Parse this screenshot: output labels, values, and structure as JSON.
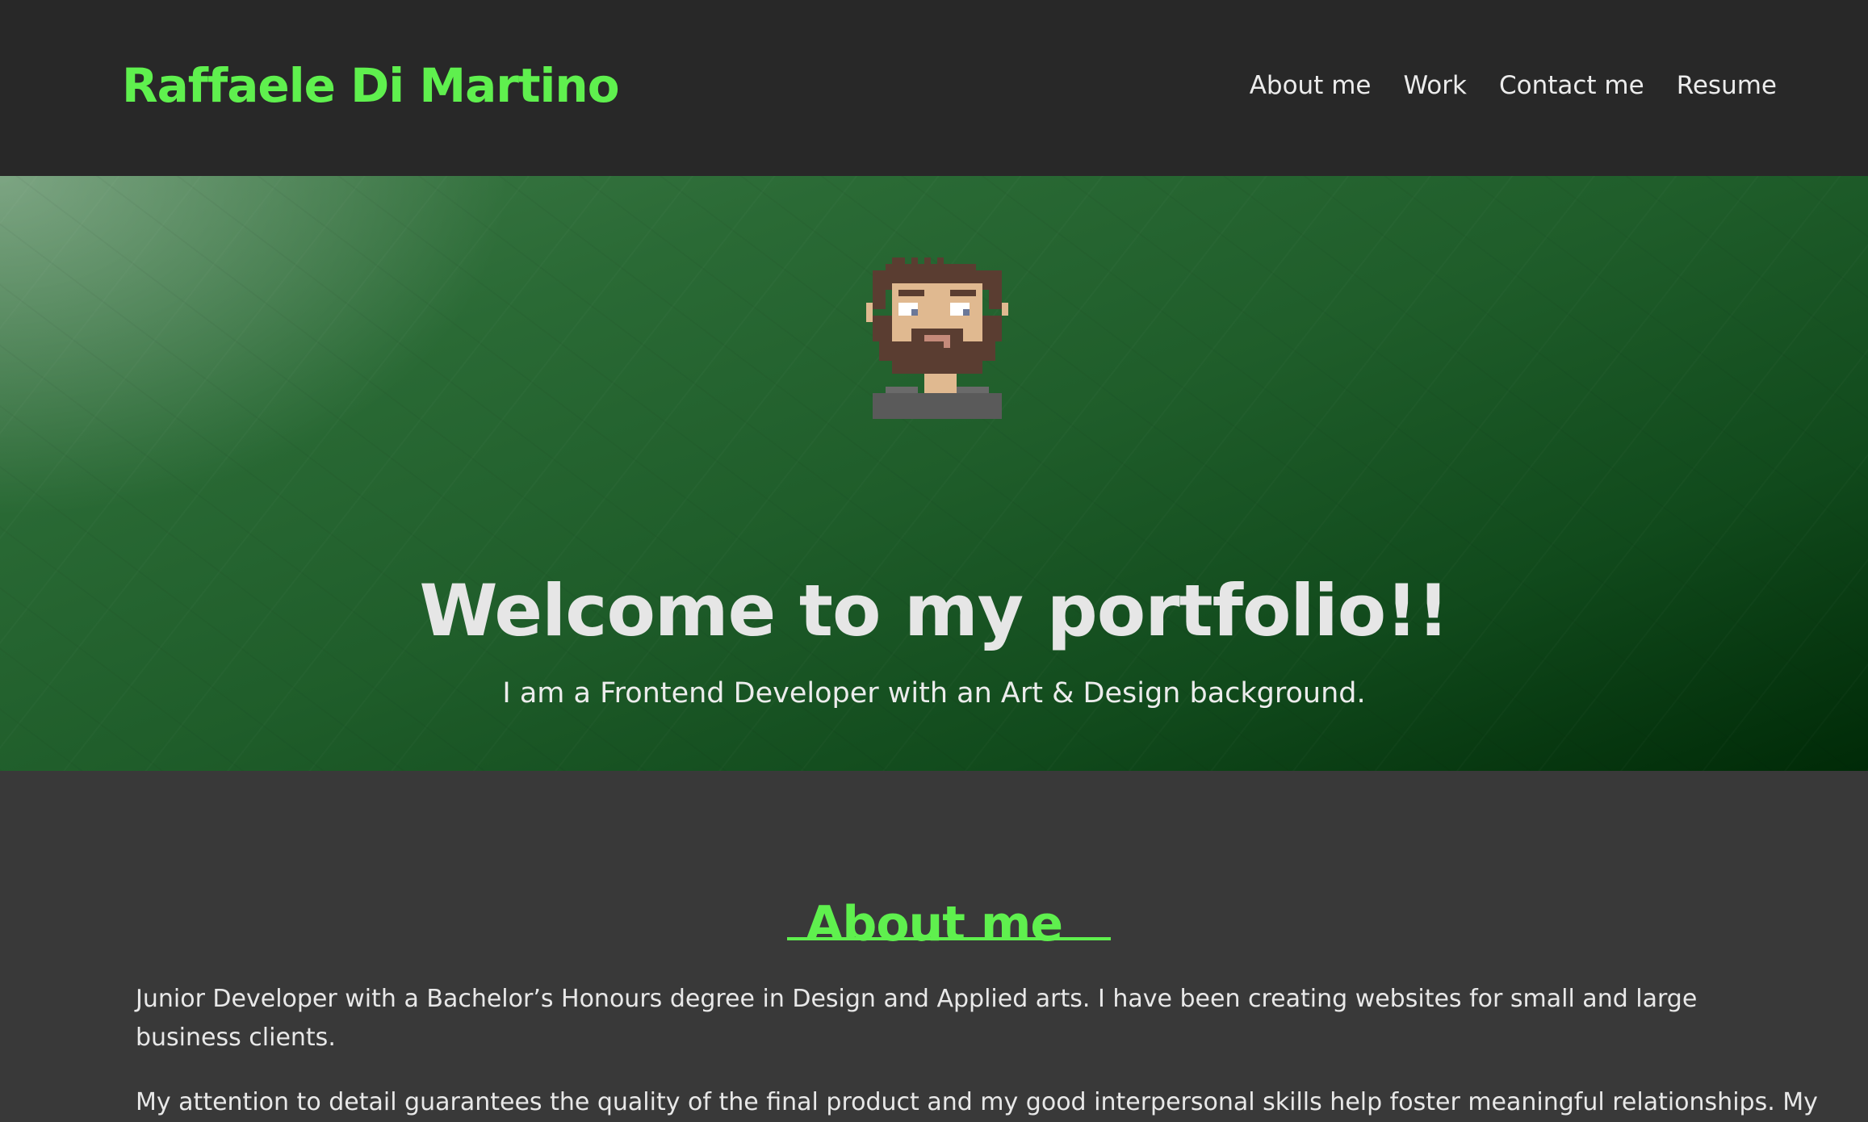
{
  "header": {
    "brand": "Raffaele Di Martino",
    "nav": [
      {
        "label": "About me"
      },
      {
        "label": "Work"
      },
      {
        "label": "Contact me"
      },
      {
        "label": "Resume"
      }
    ]
  },
  "hero": {
    "title": "Welcome to my portfolio!!",
    "subtitle": "I am a Frontend Developer with an Art & Design background.",
    "avatar_icon": "pixel-art-avatar"
  },
  "about": {
    "title": "About me",
    "paragraphs": [
      "Junior Developer with a Bachelor’s Honours degree in Design and Applied arts. I have been creating websites for small and large business clients.",
      "My attention to detail guarantees the quality of the final product and my good interpersonal skills help foster meaningful relationships. My"
    ]
  },
  "colors": {
    "accent": "#5ff04e",
    "header_bg": "#282828",
    "body_bg": "#393939",
    "hero_green": "#1f5d2a"
  }
}
